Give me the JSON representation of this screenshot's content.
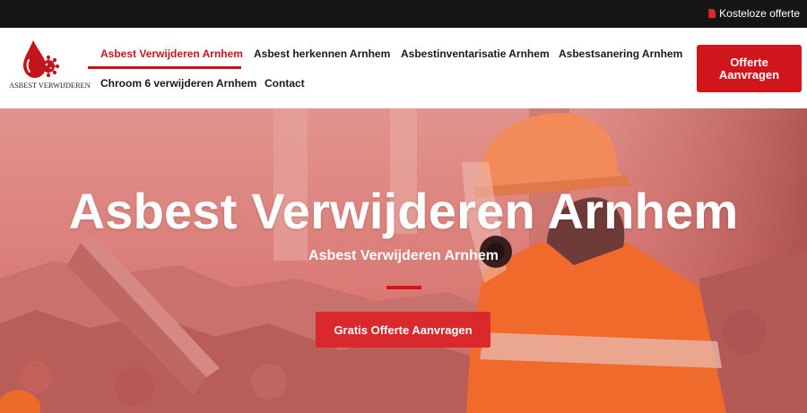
{
  "topbar": {
    "offer_label": "Kosteloze offerte",
    "offer_icon": "document-icon"
  },
  "logo": {
    "text": "ASBEST VERWIJDEREN",
    "icon": "virus-drop-icon",
    "brand_color": "#c5141b"
  },
  "nav": {
    "items": [
      {
        "label": "Asbest Verwijderen Arnhem",
        "active": true
      },
      {
        "label": "Asbest herkennen Arnhem",
        "active": false
      },
      {
        "label": "Asbestinventarisatie Arnhem",
        "active": false
      },
      {
        "label": "Asbestsanering Arnhem",
        "active": false
      },
      {
        "label": "Chroom 6 verwijderen Arnhem",
        "active": false
      },
      {
        "label": "Contact",
        "active": false
      }
    ]
  },
  "header_cta": {
    "label": "Offerte Aanvragen"
  },
  "hero": {
    "title": "Asbest Verwijderen Arnhem",
    "subtitle": "Asbest Verwijderen Arnhem",
    "button_label": "Gratis Offerte Aanvragen",
    "overlay_color": "#d8625f",
    "accent_color": "#d0151c"
  }
}
